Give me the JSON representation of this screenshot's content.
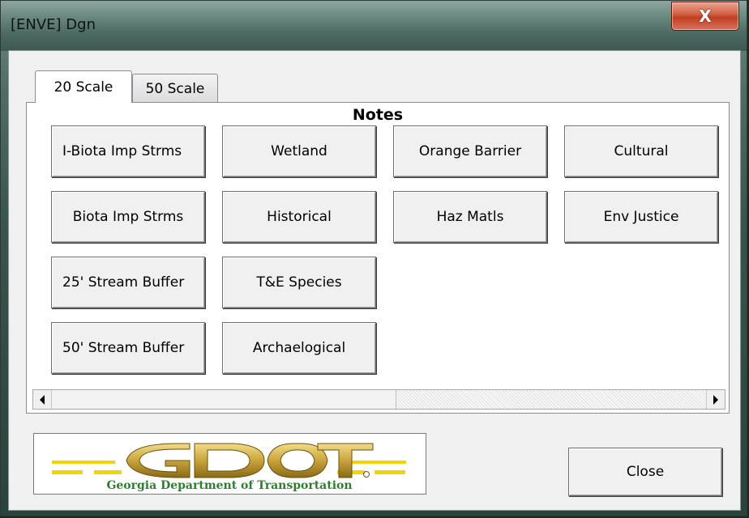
{
  "window": {
    "title": "[ENVE] Dgn",
    "close_glyph": "X"
  },
  "tabs": [
    {
      "label": "20 Scale",
      "active": true
    },
    {
      "label": "50 Scale",
      "active": false
    }
  ],
  "notes": {
    "heading": "Notes",
    "buttons": [
      "I-Biota Imp Strms",
      "Wetland",
      "Orange Barrier",
      "Cultural",
      "Biota Imp Strms",
      "Historical",
      "Haz Matls",
      "Env Justice",
      "25' Stream Buffer",
      "T&E Species",
      "50' Stream Buffer",
      "Archaelogical"
    ]
  },
  "scrollbar": {
    "left_icon": "scroll-left-arrow-icon",
    "right_icon": "scroll-right-arrow-icon"
  },
  "logo": {
    "wordmark": "GDOT",
    "tagline": "Georgia Department of Transportation",
    "colors": {
      "gold": "#c9a43a",
      "dark_gold": "#8a6a17",
      "yellow_band": "#f4d400",
      "green_text": "#2e7d32"
    }
  },
  "footer": {
    "close_label": "Close"
  }
}
